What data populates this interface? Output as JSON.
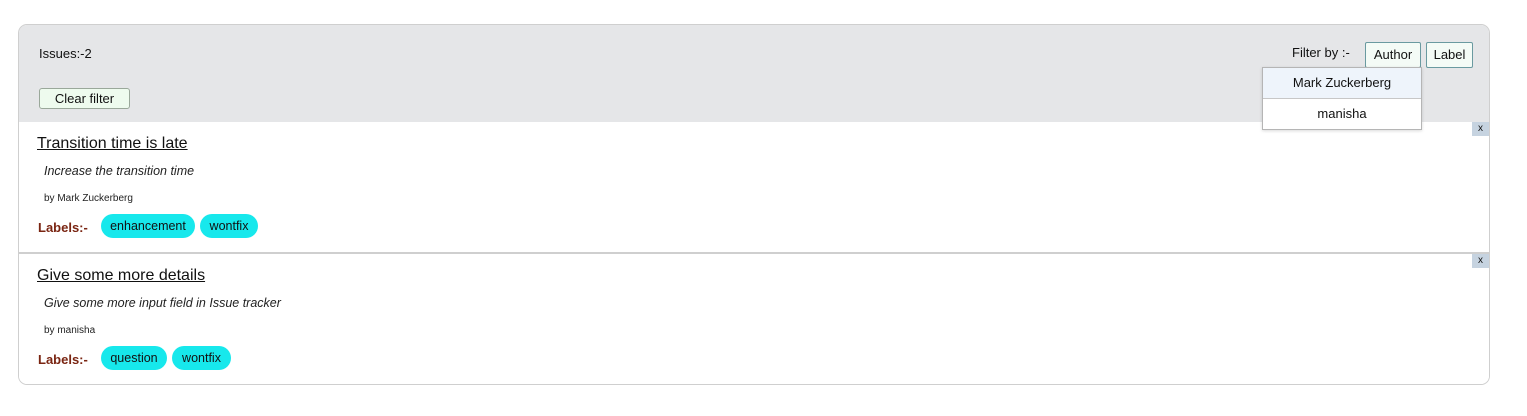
{
  "header": {
    "issues_count": "Issues:-2",
    "clear_filter_label": "Clear filter",
    "filter_by_label": "Filter by :-",
    "filter_author_label": "Author",
    "filter_label_label": "Label"
  },
  "author_dropdown": {
    "items": [
      "Mark Zuckerberg",
      "manisha"
    ]
  },
  "issues": [
    {
      "title": "Transition time is late",
      "description": "Increase the transition time",
      "author": "by Mark Zuckerberg",
      "labels_label": "Labels:-",
      "labels": [
        "enhancement",
        "wontfix"
      ],
      "close_label": "x"
    },
    {
      "title": "Give some more details",
      "description": "Give some more input field in Issue tracker",
      "author": "by manisha",
      "labels_label": "Labels:-",
      "labels": [
        "question",
        "wontfix"
      ],
      "close_label": "x"
    }
  ],
  "colors": {
    "header_bg": "#e5e6e8",
    "tag_bg": "#17e8ec",
    "labels_text": "#7a2512",
    "close_bg": "#c6d3e0"
  }
}
